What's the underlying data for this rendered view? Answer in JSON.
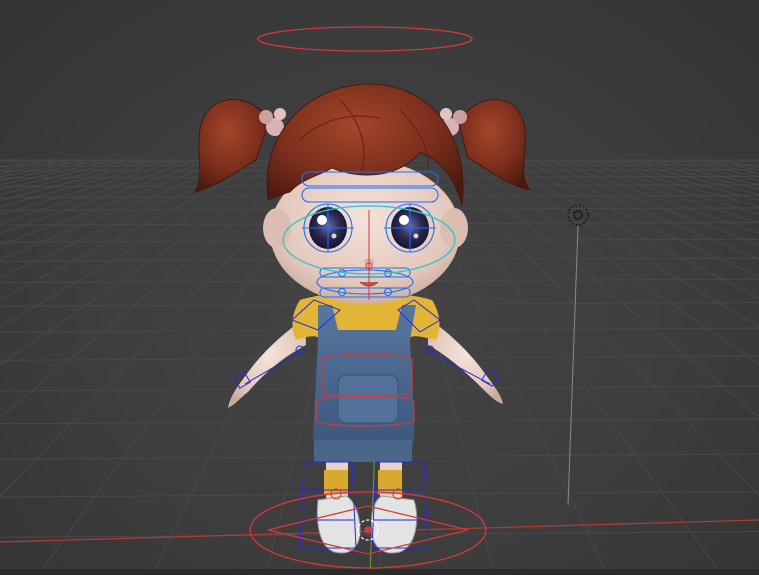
{
  "viewport": {
    "type": "3d-viewport",
    "colors": {
      "background": "#3d3d3d",
      "grid_line": "#4b4b4b",
      "x_axis": "#b03a3a",
      "y_axis": "#6f8f2f",
      "bone_wire": "#2a2ad8",
      "face_control": "#1f6ff0",
      "control_red": "#d23a3a",
      "control_cyan": "#2fc7c2",
      "light_line": "#8a8a8a",
      "hair": "#7a2e1c",
      "skin": "#e8d2c7",
      "shirt": "#e2b536",
      "overalls": "#4a6a92",
      "shoe": "#e8e8e8"
    },
    "icons": [
      "light-icon",
      "3d-cursor-icon"
    ]
  },
  "scene": {
    "character": "toon-girl-rig",
    "controls": [
      "root-control",
      "head-top-control",
      "face-controls",
      "eye-control",
      "spine-controls",
      "arm-controls",
      "leg-controls"
    ]
  }
}
